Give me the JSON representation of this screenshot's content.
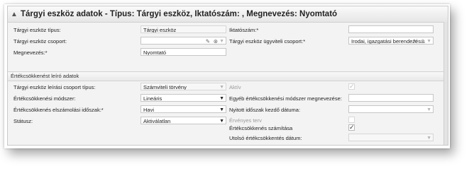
{
  "header": {
    "collapse_icon": "▲",
    "title": "Tárgyi eszköz adatok - Típus: Tárgyi eszköz, Iktatószám: , Megnevezés: Nyomtató"
  },
  "top": {
    "tipus_label": "Tárgyi eszköz típus:",
    "tipus_value": "Tárgyi eszköz",
    "csoport_label": "Tárgyi eszköz csoport:",
    "csoport_value": "",
    "megnevezes_label": "Megnevezés:*",
    "megnevezes_value": "Nyomtató",
    "iktatoszam_label": "Iktatószám:*",
    "iktatoszam_value": "",
    "ugyviteli_label": "Tárgyi eszköz ügyviteli csoport:*",
    "ugyviteli_value": "Irodai, igazgatási berendezés..."
  },
  "section": {
    "title": "Értékcsökkenést leíró adatok"
  },
  "depr": {
    "leiras_label": "Tárgyi eszköz leírási csoport típus:",
    "leiras_value": "Számviteli törvény",
    "modszer_label": "Értékcsökkenési módszer:",
    "modszer_value": "Lineáris",
    "idoszak_label": "Értékcsökkenés elszámolási időszak:*",
    "idoszak_value": "Havi",
    "statusz_label": "Státusz:",
    "statusz_value": "Aktiválatlan",
    "aktiv_label": "Aktív",
    "egyeb_label": "Egyéb értékcsökkenési módszer megnevezése:",
    "egyeb_value": "",
    "nyitott_label": "Nyitott időszak kezdő dátuma:",
    "nyitott_value": "",
    "ervenyes_label": "Érvényes terv",
    "szamitas_label": "Értékcsökkenés számítása",
    "utolso_label": "Utolsó értékcsökkentés dátum:",
    "utolso_value": ""
  },
  "icons": {
    "dropdown": "▼",
    "pencil": "✎",
    "clear": "⊗",
    "check": "✓"
  }
}
